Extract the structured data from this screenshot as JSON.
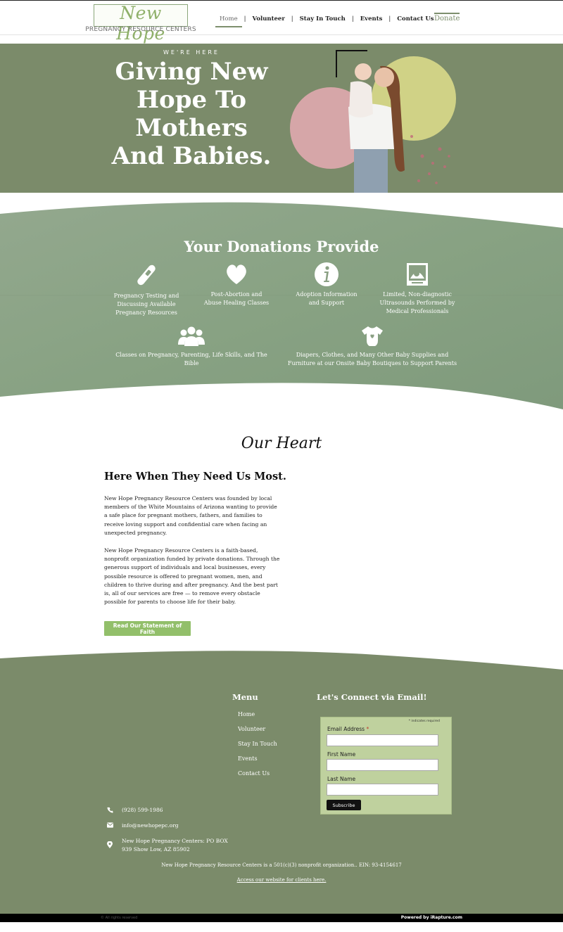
{
  "header": {
    "logo_script": "New Hope",
    "logo_sub": "PREGNANCY RESOURCE CENTERS",
    "nav": [
      "Home",
      "Volunteer",
      "Stay In Touch",
      "Events",
      "Contact Us"
    ],
    "donate": "Donate"
  },
  "hero": {
    "eyebrow": "WE'RE HERE",
    "title": "Giving New Hope To Mothers And Babies."
  },
  "donations": {
    "title": "Your Donations Provide",
    "items": [
      {
        "label": "Pregnancy Testing and Discussing Available Pregnancy Resources",
        "icon": "pregnancy-test-icon"
      },
      {
        "label": "Post-Abortion and Abuse Healing Classes",
        "icon": "heart-icon"
      },
      {
        "label": "Adoption Information and Support",
        "icon": "info-icon"
      },
      {
        "label": "Limited, Non-diagnostic Ultrasounds Performed by Medical Professionals",
        "icon": "ultrasound-icon"
      },
      {
        "label": "Classes on Pregnancy, Parenting, Life Skills, and The Bible",
        "icon": "group-icon"
      },
      {
        "label": "Diapers, Clothes, and Many Other Baby Supplies and Furniture at our Onsite Baby Boutiques to Support Parents",
        "icon": "onesie-icon"
      }
    ]
  },
  "heart": {
    "script_title": "Our Heart",
    "heading": "Here When They Need Us Most.",
    "para1": "New Hope Pregnancy Resource Centers was founded by local members of the White Mountains of Arizona wanting to provide a safe place for pregnant mothers, fathers, and families to receive loving support and confidential care when facing an unexpected pregnancy.",
    "para2": "New Hope Pregnancy Resource Centers is a faith-based, nonprofit organization funded by private donations. Through the generous support of individuals and local businesses, every possible resource is offered to pregnant women, men, and children to thrive during and after pregnancy. And the best part is, all of our services are free — to remove every obstacle possible for parents to choose life for their baby.",
    "button": "Read Our Statement of Faith"
  },
  "footer": {
    "menu_title": "Menu",
    "menu": [
      "Home",
      "Volunteer",
      "Stay In Touch",
      "Events",
      "Contact Us"
    ],
    "connect_title": "Let's Connect via Email!",
    "form": {
      "required_note": "* indicates required",
      "email_label": "Email Address",
      "required_mark": "*",
      "first_label": "First Name",
      "last_label": "Last Name",
      "subscribe": "Subscribe"
    },
    "phone": "(928) 599-1986",
    "email": "info@newhopepc.org",
    "address_line1": "New Hope Pregnancy Centers: PO BOX",
    "address_line2": "939 Show Low, AZ 85902",
    "nonprofit": "New Hope Pregnancy Resource Centers is a 501(c)(3) nonprofit organization.. EIN: 93-4154617",
    "clients_link": "Access our website for clients here.",
    "copyright": "© All rights reserved",
    "powered": "Powered by iRapture.com"
  },
  "colors": {
    "sage": "#7b8b6a",
    "light_green": "#92bf6a",
    "form_bg": "#bfd19e"
  }
}
